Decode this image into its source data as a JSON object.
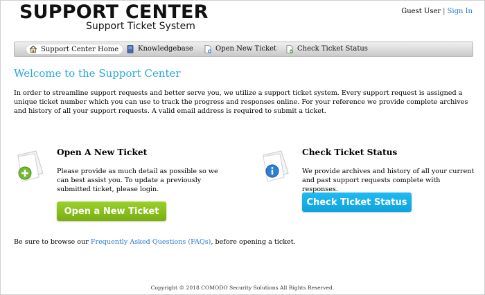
{
  "header": {
    "logo_title": "SUPPORT CENTER",
    "logo_subtitle": "Support Ticket System",
    "guest_label": "Guest User",
    "separator": "|",
    "signin_label": "Sign In"
  },
  "nav": {
    "items": [
      {
        "label": "Support Center Home",
        "icon": "home-icon"
      },
      {
        "label": "Knowledgebase",
        "icon": "book-icon"
      },
      {
        "label": "Open New Ticket",
        "icon": "new-ticket-icon"
      },
      {
        "label": "Check Ticket Status",
        "icon": "ticket-status-icon"
      }
    ]
  },
  "main": {
    "welcome_title": "Welcome to the Support Center",
    "intro_text": "In order to streamline support requests and better serve you, we utilize a support ticket system. Every support request is assigned a unique ticket number which you can use to track the progress and responses online. For your reference we provide complete archives and history of all your support requests. A valid email address is required to submit a ticket.",
    "open_section": {
      "title": "Open A New Ticket",
      "text": "Please provide as much detail as possible so we can best assist you. To update a previously submitted ticket, please login.",
      "button_label": "Open a New Ticket",
      "button_color": "#8cc21f"
    },
    "check_section": {
      "title": "Check Ticket Status",
      "text": "We provide archives and history of all your current and past support requests complete with responses.",
      "button_label": "Check Ticket Status",
      "button_color": "#19b0ea"
    },
    "faq_before": "Be sure to browse our ",
    "faq_link": "Frequently Asked Questions (FAQs)",
    "faq_after": ", before opening a ticket."
  },
  "footer": {
    "copyright": "Copyright © 2018 COMODO Security Solutions All Rights Reserved."
  },
  "colors": {
    "accent": "#29a8dc",
    "link": "#2277cc"
  }
}
